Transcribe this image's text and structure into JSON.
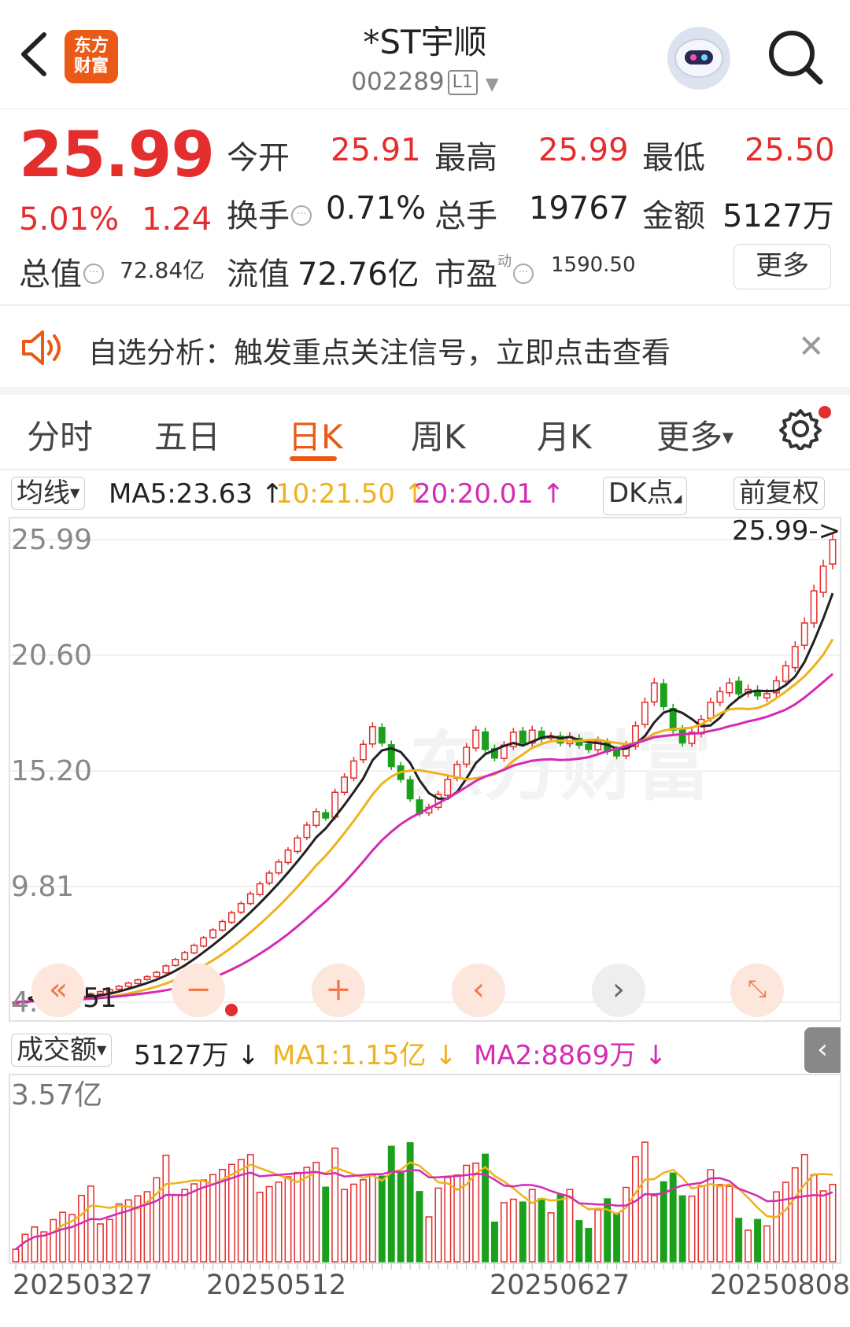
{
  "header": {
    "title": "*ST宇顺",
    "code": "002289",
    "level": "L1",
    "logo_line1": "东方",
    "logo_line2": "财富"
  },
  "quote": {
    "price": "25.99",
    "change_pct": "5.01%",
    "change_amt": "1.24",
    "open_label": "今开",
    "open": "25.91",
    "high_label": "最高",
    "high": "25.99",
    "low_label": "最低",
    "low": "25.50",
    "turnover_label": "换手",
    "turnover": "0.71%",
    "volume_label": "总手",
    "volume": "19767",
    "amount_label": "金额",
    "amount": "5127万",
    "mktcap_label": "总值",
    "mktcap": "72.84亿",
    "float_label": "流值",
    "float_cap": "72.76亿",
    "pe_label": "市盈",
    "pe_sup": "动",
    "pe": "1590.50",
    "more_label": "更多"
  },
  "notice": {
    "text": "自选分析：触发重点关注信号，立即点击查看",
    "close": "✕"
  },
  "tabs": {
    "items": [
      "分时",
      "五日",
      "日K",
      "周K",
      "月K",
      "更多"
    ],
    "active": "日K"
  },
  "indicators": {
    "ma_selector": "均线",
    "ma5": "MA5:23.63",
    "ma10": "10:21.50",
    "ma20": "20:20.01",
    "dk": "DK点",
    "adjust": "前复权"
  },
  "volume_header": {
    "selector": "成交额",
    "value": "5127万",
    "ma1": "MA1:1.15亿",
    "ma2": "MA2:8869万"
  },
  "colors": {
    "up": "#e42d2d",
    "down": "#1aa01a",
    "ma5": "#222222",
    "ma10": "#efb21b",
    "ma20": "#d42bb5",
    "accent": "#ea5a16"
  },
  "chart_data": {
    "type": "candlestick",
    "price_axis": {
      "ticks": [
        "25.99",
        "20.60",
        "15.20",
        "9.81",
        "4.41"
      ],
      "ylim": [
        4.41,
        25.99
      ]
    },
    "annotations": {
      "max_label": "25.99->",
      "min_label": "<-4.51"
    },
    "x_labels": [
      "20250327",
      "20250512",
      "20250627",
      "20250808"
    ],
    "series_closes": [
      4.41,
      4.45,
      4.5,
      4.51,
      4.55,
      4.6,
      4.62,
      4.7,
      4.8,
      4.9,
      5.0,
      5.15,
      5.3,
      5.45,
      5.6,
      5.8,
      6.1,
      6.4,
      6.72,
      7.06,
      7.41,
      7.78,
      8.17,
      8.58,
      9.01,
      9.46,
      9.93,
      10.43,
      10.95,
      11.5,
      12.07,
      12.67,
      13.3,
      13.0,
      14.2,
      14.91,
      15.66,
      16.44,
      17.26,
      16.5,
      15.4,
      14.8,
      13.9,
      13.2,
      13.5,
      14.1,
      14.8,
      15.5,
      16.3,
      17.1,
      16.2,
      15.8,
      16.4,
      17.0,
      16.5,
      17.1,
      16.7,
      16.8,
      16.5,
      16.8,
      16.4,
      16.2,
      16.6,
      16.1,
      15.9,
      16.4,
      17.3,
      18.4,
      19.3,
      18.2,
      17.1,
      16.5,
      17.0,
      17.6,
      18.4,
      18.9,
      19.3,
      18.8,
      19.0,
      18.7,
      18.8,
      19.4,
      20.1,
      21.0,
      22.1,
      23.6,
      24.75,
      25.99
    ],
    "volume_axis": {
      "top_label": "3.57亿",
      "ylim": [
        0,
        3.57
      ]
    },
    "ma_series": [
      "MA5",
      "MA10",
      "MA20"
    ]
  }
}
